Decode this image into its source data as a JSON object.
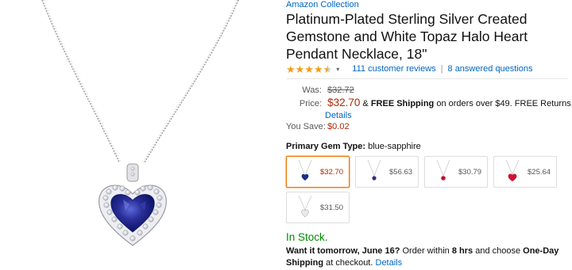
{
  "product": {
    "brand": "Amazon Collection",
    "title": "Platinum-Plated Sterling Silver Created Gemstone and White Topaz Halo Heart Pendant Necklace, 18\"",
    "reviews": "111 customer reviews",
    "separator": "|",
    "answered": "8 answered questions",
    "rating_stars": 4.5,
    "star_glyph": "★",
    "caret_glyph": "▾"
  },
  "price": {
    "was_label": "Was:",
    "was_value": "$32.72",
    "price_label": "Price:",
    "price_value": "$32.70",
    "amp": "&",
    "free_shipping": "FREE Shipping",
    "shipping_note": "on orders over $49. FREE Returns.",
    "details": "Details",
    "save_label": "You Save:",
    "save_value": "$0.02"
  },
  "gem": {
    "label": "Primary Gem Type:",
    "value": "blue-sapphire"
  },
  "swatches": [
    {
      "price": "$32.70",
      "gem_color": "#1b2f8a",
      "selected": true
    },
    {
      "price": "$56.63",
      "gem_color": "#3a2a7a",
      "selected": false
    },
    {
      "price": "$30.79",
      "gem_color": "#c0142c",
      "selected": false
    },
    {
      "price": "$25.64",
      "gem_color": "#d01232",
      "selected": false
    },
    {
      "price": "$31.50",
      "gem_color": "#e8e8ee",
      "selected": false
    }
  ],
  "stock": {
    "status": "In Stock.",
    "want": "Want it tomorrow, June 16?",
    "order_within": "Order within",
    "hours": "8 hrs",
    "and_choose": "and choose",
    "one_day": "One-Day Shipping",
    "at_checkout": "at checkout.",
    "details": "Details"
  },
  "colors": {
    "link": "#0066c0",
    "price_red": "#b12704",
    "stock_green": "#008a00",
    "star": "#f19e19",
    "sapphire": "#1b2f8a"
  }
}
